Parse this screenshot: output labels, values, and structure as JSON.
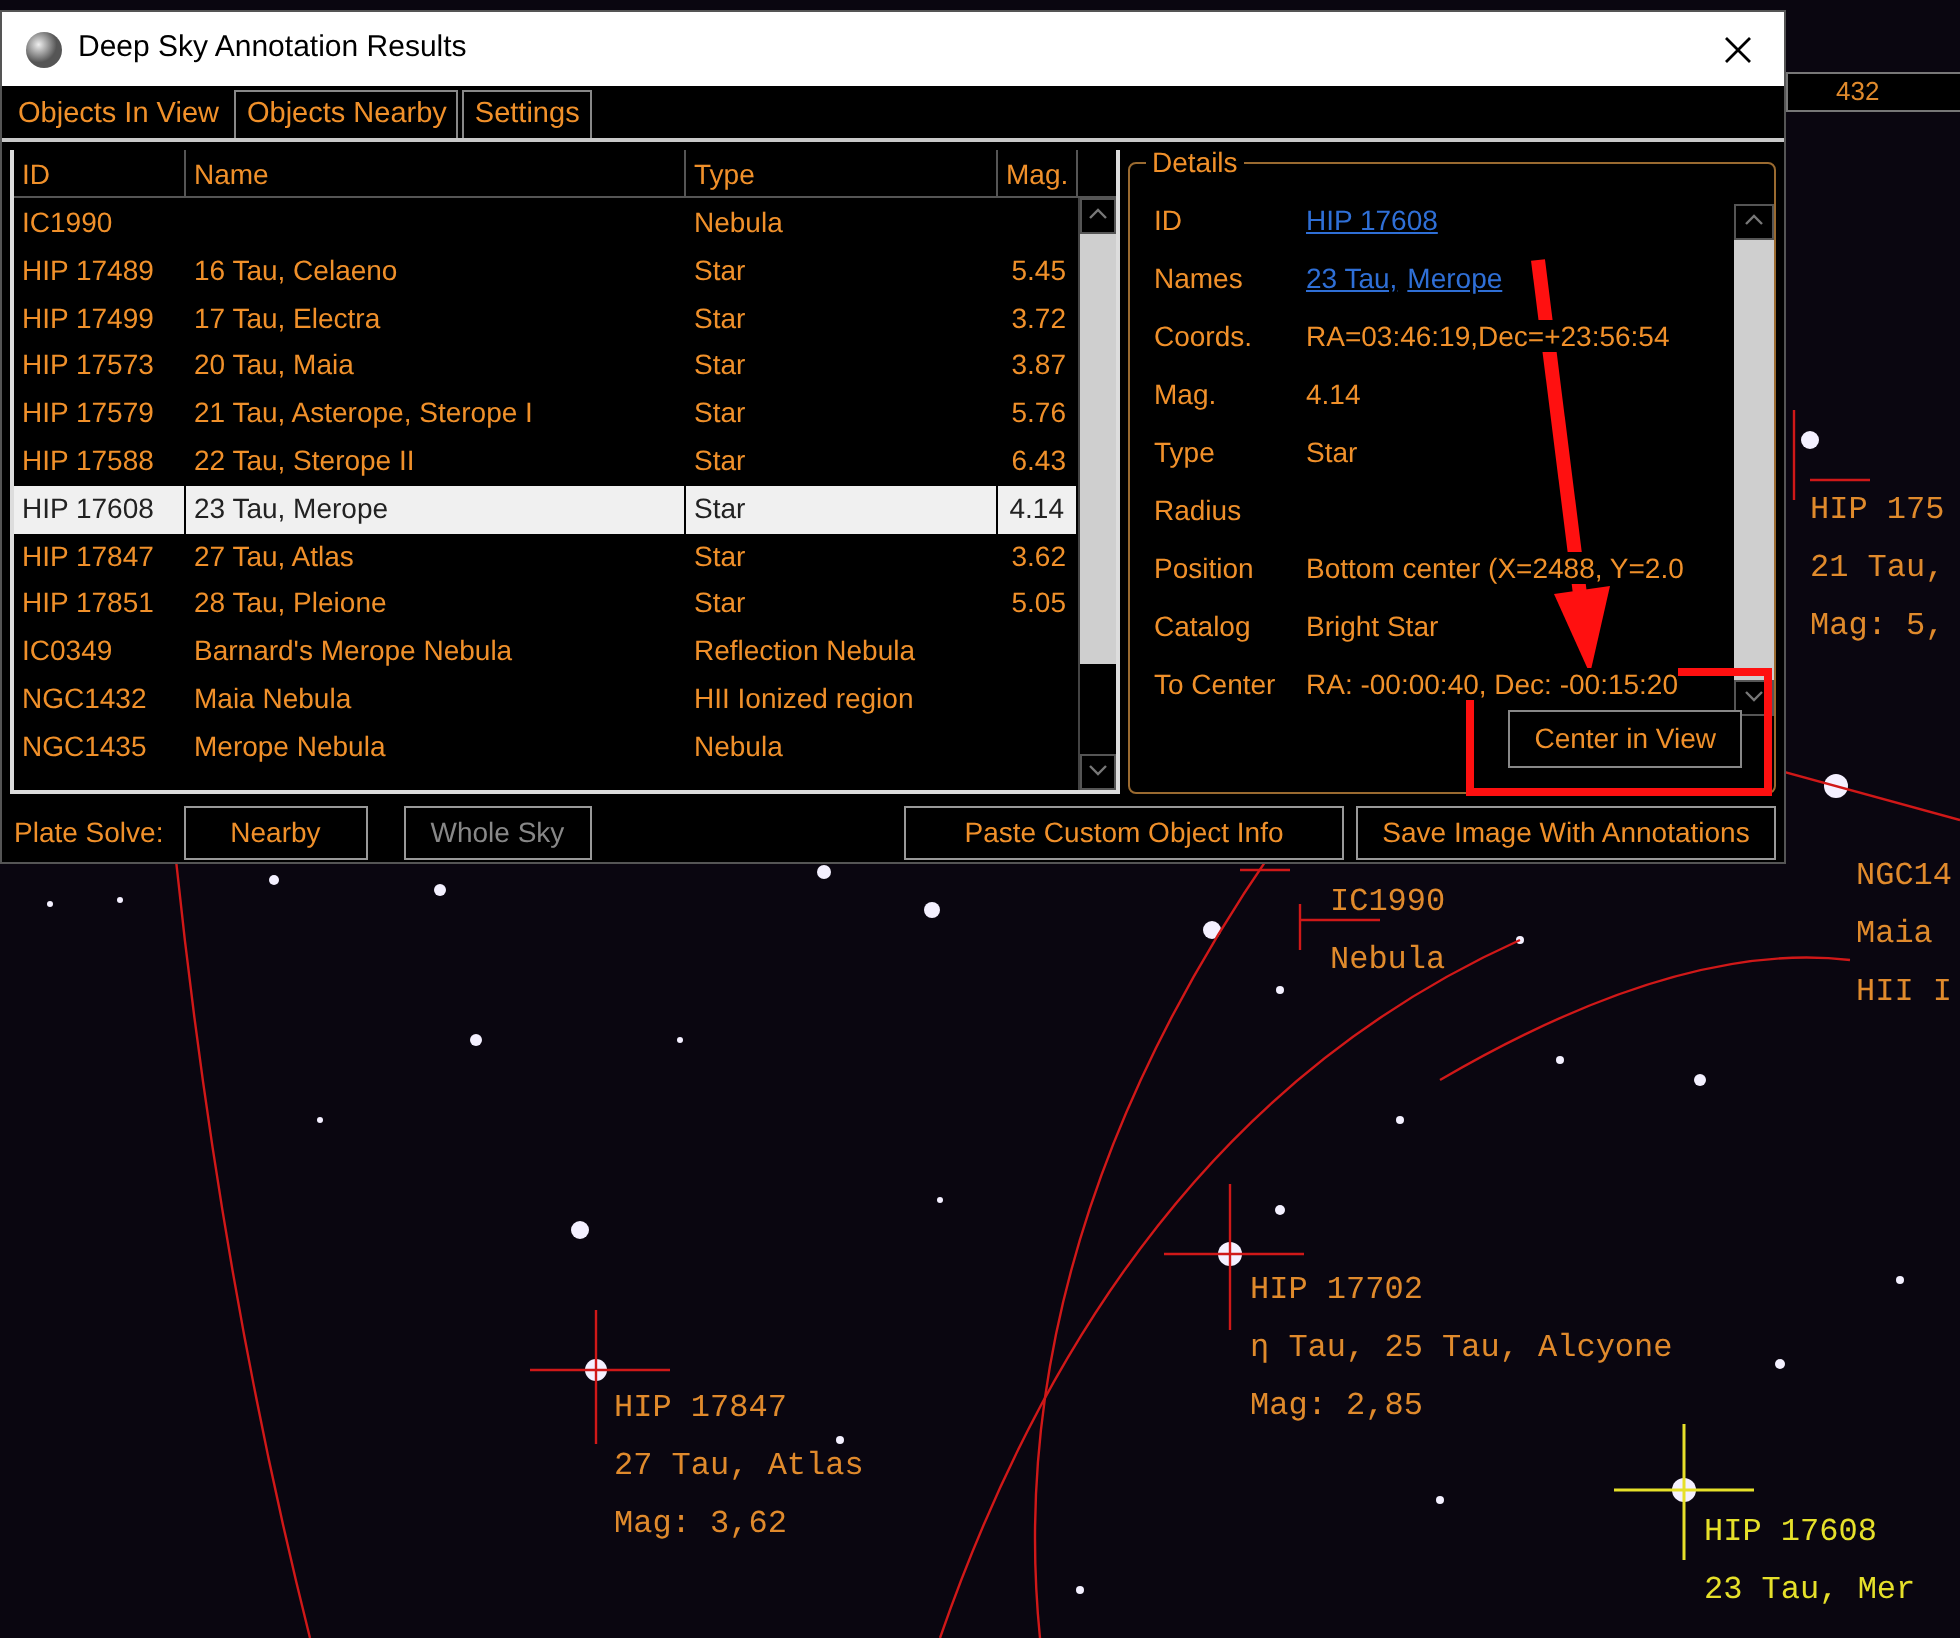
{
  "window": {
    "title": "Deep Sky Annotation Results"
  },
  "background_field": {
    "value": "432"
  },
  "tabs": [
    {
      "label": "Objects In View",
      "selected": true
    },
    {
      "label": "Objects Nearby",
      "selected": false
    },
    {
      "label": "Settings",
      "selected": false
    }
  ],
  "table": {
    "columns": [
      "ID",
      "Name",
      "Type",
      "Mag."
    ],
    "rows": [
      {
        "cells": [
          "IC1990",
          "",
          "Nebula",
          ""
        ],
        "selected": false
      },
      {
        "cells": [
          "HIP 17489",
          "16 Tau, Celaeno",
          "Star",
          "5.45"
        ],
        "selected": false
      },
      {
        "cells": [
          "HIP 17499",
          "17 Tau, Electra",
          "Star",
          "3.72"
        ],
        "selected": false
      },
      {
        "cells": [
          "HIP 17573",
          "20 Tau, Maia",
          "Star",
          "3.87"
        ],
        "selected": false
      },
      {
        "cells": [
          "HIP 17579",
          "21 Tau, Asterope, Sterope I",
          "Star",
          "5.76"
        ],
        "selected": false
      },
      {
        "cells": [
          "HIP 17588",
          "22 Tau, Sterope II",
          "Star",
          "6.43"
        ],
        "selected": false
      },
      {
        "cells": [
          "HIP 17608",
          "23 Tau, Merope",
          "Star",
          "4.14"
        ],
        "selected": true
      },
      {
        "cells": [
          "HIP 17847",
          "27 Tau, Atlas",
          "Star",
          "3.62"
        ],
        "selected": false
      },
      {
        "cells": [
          "HIP 17851",
          "28 Tau, Pleione",
          "Star",
          "5.05"
        ],
        "selected": false
      },
      {
        "cells": [
          "IC0349",
          "Barnard's Merope Nebula",
          "Reflection Nebula",
          ""
        ],
        "selected": false
      },
      {
        "cells": [
          "NGC1432",
          "Maia Nebula",
          "HII Ionized region",
          ""
        ],
        "selected": false
      },
      {
        "cells": [
          "NGC1435",
          "Merope Nebula",
          "Nebula",
          ""
        ],
        "selected": false
      }
    ]
  },
  "details": {
    "title": "Details",
    "fields": [
      {
        "label": "ID",
        "kind": "link",
        "values": [
          "HIP 17608"
        ]
      },
      {
        "label": "Names",
        "kind": "link",
        "values": [
          "23 Tau,",
          "Merope"
        ]
      },
      {
        "label": "Coords.",
        "kind": "text",
        "values": [
          "RA=03:46:19,Dec=+23:56:54"
        ]
      },
      {
        "label": "Mag.",
        "kind": "text",
        "values": [
          "4.14"
        ]
      },
      {
        "label": "Type",
        "kind": "text",
        "values": [
          "Star"
        ]
      },
      {
        "label": "Radius"
      },
      {
        "label": "Position",
        "kind": "text",
        "values": [
          "Bottom center (X=2488, Y=2.0"
        ]
      },
      {
        "label": "Catalog",
        "kind": "text",
        "values": [
          "Bright Star"
        ]
      },
      {
        "label": "To Center",
        "kind": "text",
        "values": [
          "RA: -00:00:40, Dec: -00:15:20"
        ]
      }
    ],
    "action": "Center in View"
  },
  "bottom_bar": {
    "label": "Plate Solve:",
    "buttons": [
      {
        "label": "Nearby",
        "disabled": false
      },
      {
        "label": "Whole Sky",
        "disabled": true
      }
    ],
    "actions": [
      "Paste Custom Object Info",
      "Save Image With Annotations"
    ]
  },
  "sky_labels": [
    {
      "lines": [
        "HIP 175",
        "21 Tau,",
        "Mag: 5,"
      ],
      "color": "#e08a2c"
    },
    {
      "lines": [
        "IC1990",
        "Nebula"
      ],
      "color": "#e08a2c"
    },
    {
      "lines": [
        "NGC14",
        "Maia",
        "HII I"
      ],
      "color": "#e08a2c"
    },
    {
      "lines": [
        "HIP 17702",
        "η Tau, 25 Tau, Alcyone",
        "Mag: 2,85"
      ],
      "color": "#e08a2c"
    },
    {
      "lines": [
        "HIP 17847",
        "27 Tau, Atlas",
        "Mag: 3,62"
      ],
      "color": "#e08a2c"
    },
    {
      "lines": [
        "HIP 17608",
        "23 Tau, Mer"
      ],
      "color": "#e6e02a"
    }
  ]
}
